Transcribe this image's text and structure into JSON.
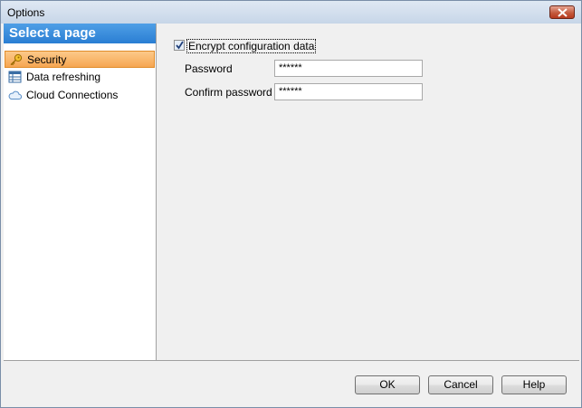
{
  "window": {
    "title": "Options"
  },
  "sidebar": {
    "header": "Select a page",
    "items": [
      {
        "label": "Security",
        "icon": "key-icon",
        "selected": true
      },
      {
        "label": "Data refreshing",
        "icon": "table-icon",
        "selected": false
      },
      {
        "label": "Cloud Connections",
        "icon": "cloud-icon",
        "selected": false
      }
    ]
  },
  "security": {
    "encrypt_label": "Encrypt configuration data",
    "encrypt_checked": true,
    "password_label": "Password",
    "password_value": "******",
    "confirm_label": "Confirm password",
    "confirm_value": "******"
  },
  "buttons": {
    "ok": "OK",
    "cancel": "Cancel",
    "help": "Help"
  },
  "colors": {
    "accent": "#2a7ed3",
    "selection": "#f6a651",
    "close": "#c45b3e"
  }
}
